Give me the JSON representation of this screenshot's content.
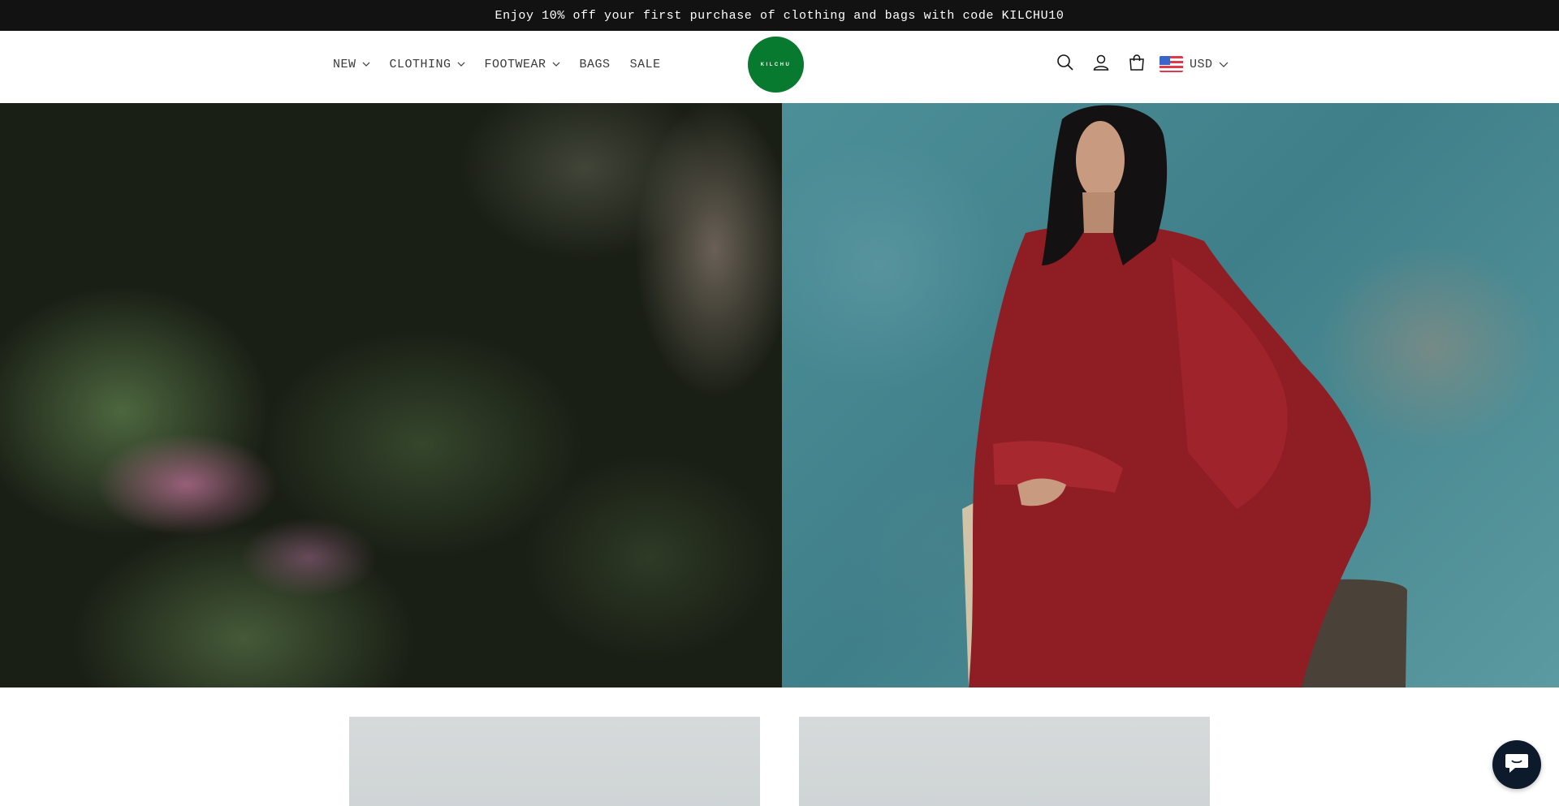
{
  "announcement": {
    "text": "Enjoy 10% off your first purchase of clothing and bags with code KILCHU10"
  },
  "nav": {
    "items": [
      {
        "label": "NEW",
        "has_dropdown": true
      },
      {
        "label": "CLOTHING",
        "has_dropdown": true
      },
      {
        "label": "FOOTWEAR",
        "has_dropdown": true
      },
      {
        "label": "BAGS",
        "has_dropdown": false
      },
      {
        "label": "SALE",
        "has_dropdown": false
      }
    ]
  },
  "logo": {
    "text": "KILCHU",
    "color": "#087a2f"
  },
  "header_icons": {
    "search": "search-icon",
    "account": "account-icon",
    "cart": "cart-icon"
  },
  "currency": {
    "selected": "USD",
    "flag": "us-flag-icon"
  },
  "hero": {
    "left_image": "blurred-foliage-image",
    "right_image": "model-in-red-coat-image"
  },
  "cards": [
    {
      "image": "product-card-image-1"
    },
    {
      "image": "product-card-image-2"
    }
  ],
  "chat": {
    "icon": "chat-bubble-icon",
    "color": "#0d1a2c"
  }
}
